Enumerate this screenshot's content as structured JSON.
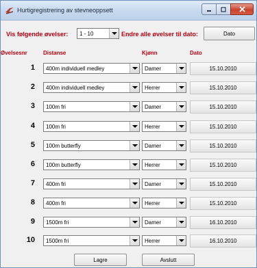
{
  "window": {
    "title": "Hurtigregistrering av stevneoppsett"
  },
  "filter": {
    "show_label": "Vis følgende øvelser:",
    "range_value": "1 - 10",
    "change_label": "Endre alle øvelser til dato:",
    "date_button": "Dato"
  },
  "headers": {
    "number": "Øvelsesnr",
    "distance": "Distanse",
    "gender": "Kjønn",
    "date": "Dato"
  },
  "rows": [
    {
      "number": "1",
      "distance": "400m individuell medley",
      "gender": "Damer",
      "date": "15.10.2010"
    },
    {
      "number": "2",
      "distance": "400m individuell medley",
      "gender": "Herrer",
      "date": "15.10.2010"
    },
    {
      "number": "3",
      "distance": "100m fri",
      "gender": "Damer",
      "date": "15.10.2010"
    },
    {
      "number": "4",
      "distance": "100m fri",
      "gender": "Herrer",
      "date": "15.10.2010"
    },
    {
      "number": "5",
      "distance": "100m butterfly",
      "gender": "Damer",
      "date": "15.10.2010"
    },
    {
      "number": "6",
      "distance": "100m butterfly",
      "gender": "Herrer",
      "date": "15.10.2010"
    },
    {
      "number": "7",
      "distance": "400m fri",
      "gender": "Damer",
      "date": "15.10.2010"
    },
    {
      "number": "8",
      "distance": "400m fri",
      "gender": "Herrer",
      "date": "15.10.2010"
    },
    {
      "number": "9",
      "distance": "1500m fri",
      "gender": "Damer",
      "date": "16.10.2010"
    },
    {
      "number": "10",
      "distance": "1500m fri",
      "gender": "Herrer",
      "date": "16.10.2010"
    }
  ],
  "buttons": {
    "save": "Lagre",
    "exit": "Avslutt"
  },
  "colors": {
    "label_red": "#c0000e",
    "titlebar": "#c6d8ee",
    "close_button": "#c9452f"
  },
  "icons": {
    "app": "swimmer-icon",
    "minimize": "minimize-icon",
    "maximize": "maximize-icon",
    "close": "close-icon"
  }
}
